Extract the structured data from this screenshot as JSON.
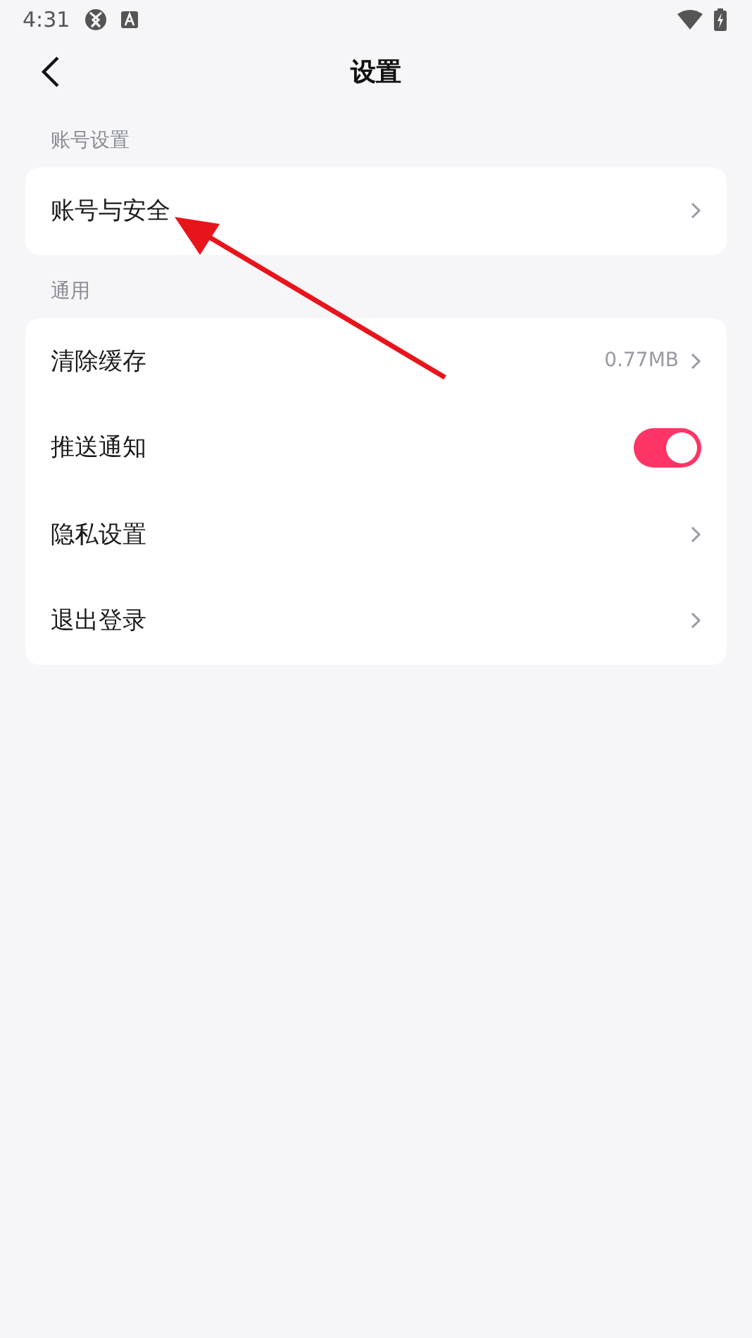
{
  "status_bar": {
    "time": "4:31"
  },
  "header": {
    "title": "设置"
  },
  "sections": [
    {
      "label": "账号设置",
      "rows": [
        {
          "kind": "link",
          "label": "账号与安全"
        }
      ]
    },
    {
      "label": "通用",
      "rows": [
        {
          "kind": "link",
          "label": "清除缓存",
          "value": "0.77MB"
        },
        {
          "kind": "toggle",
          "label": "推送通知",
          "on": true
        },
        {
          "kind": "link",
          "label": "隐私设置"
        },
        {
          "kind": "link",
          "label": "退出登录"
        }
      ]
    }
  ]
}
